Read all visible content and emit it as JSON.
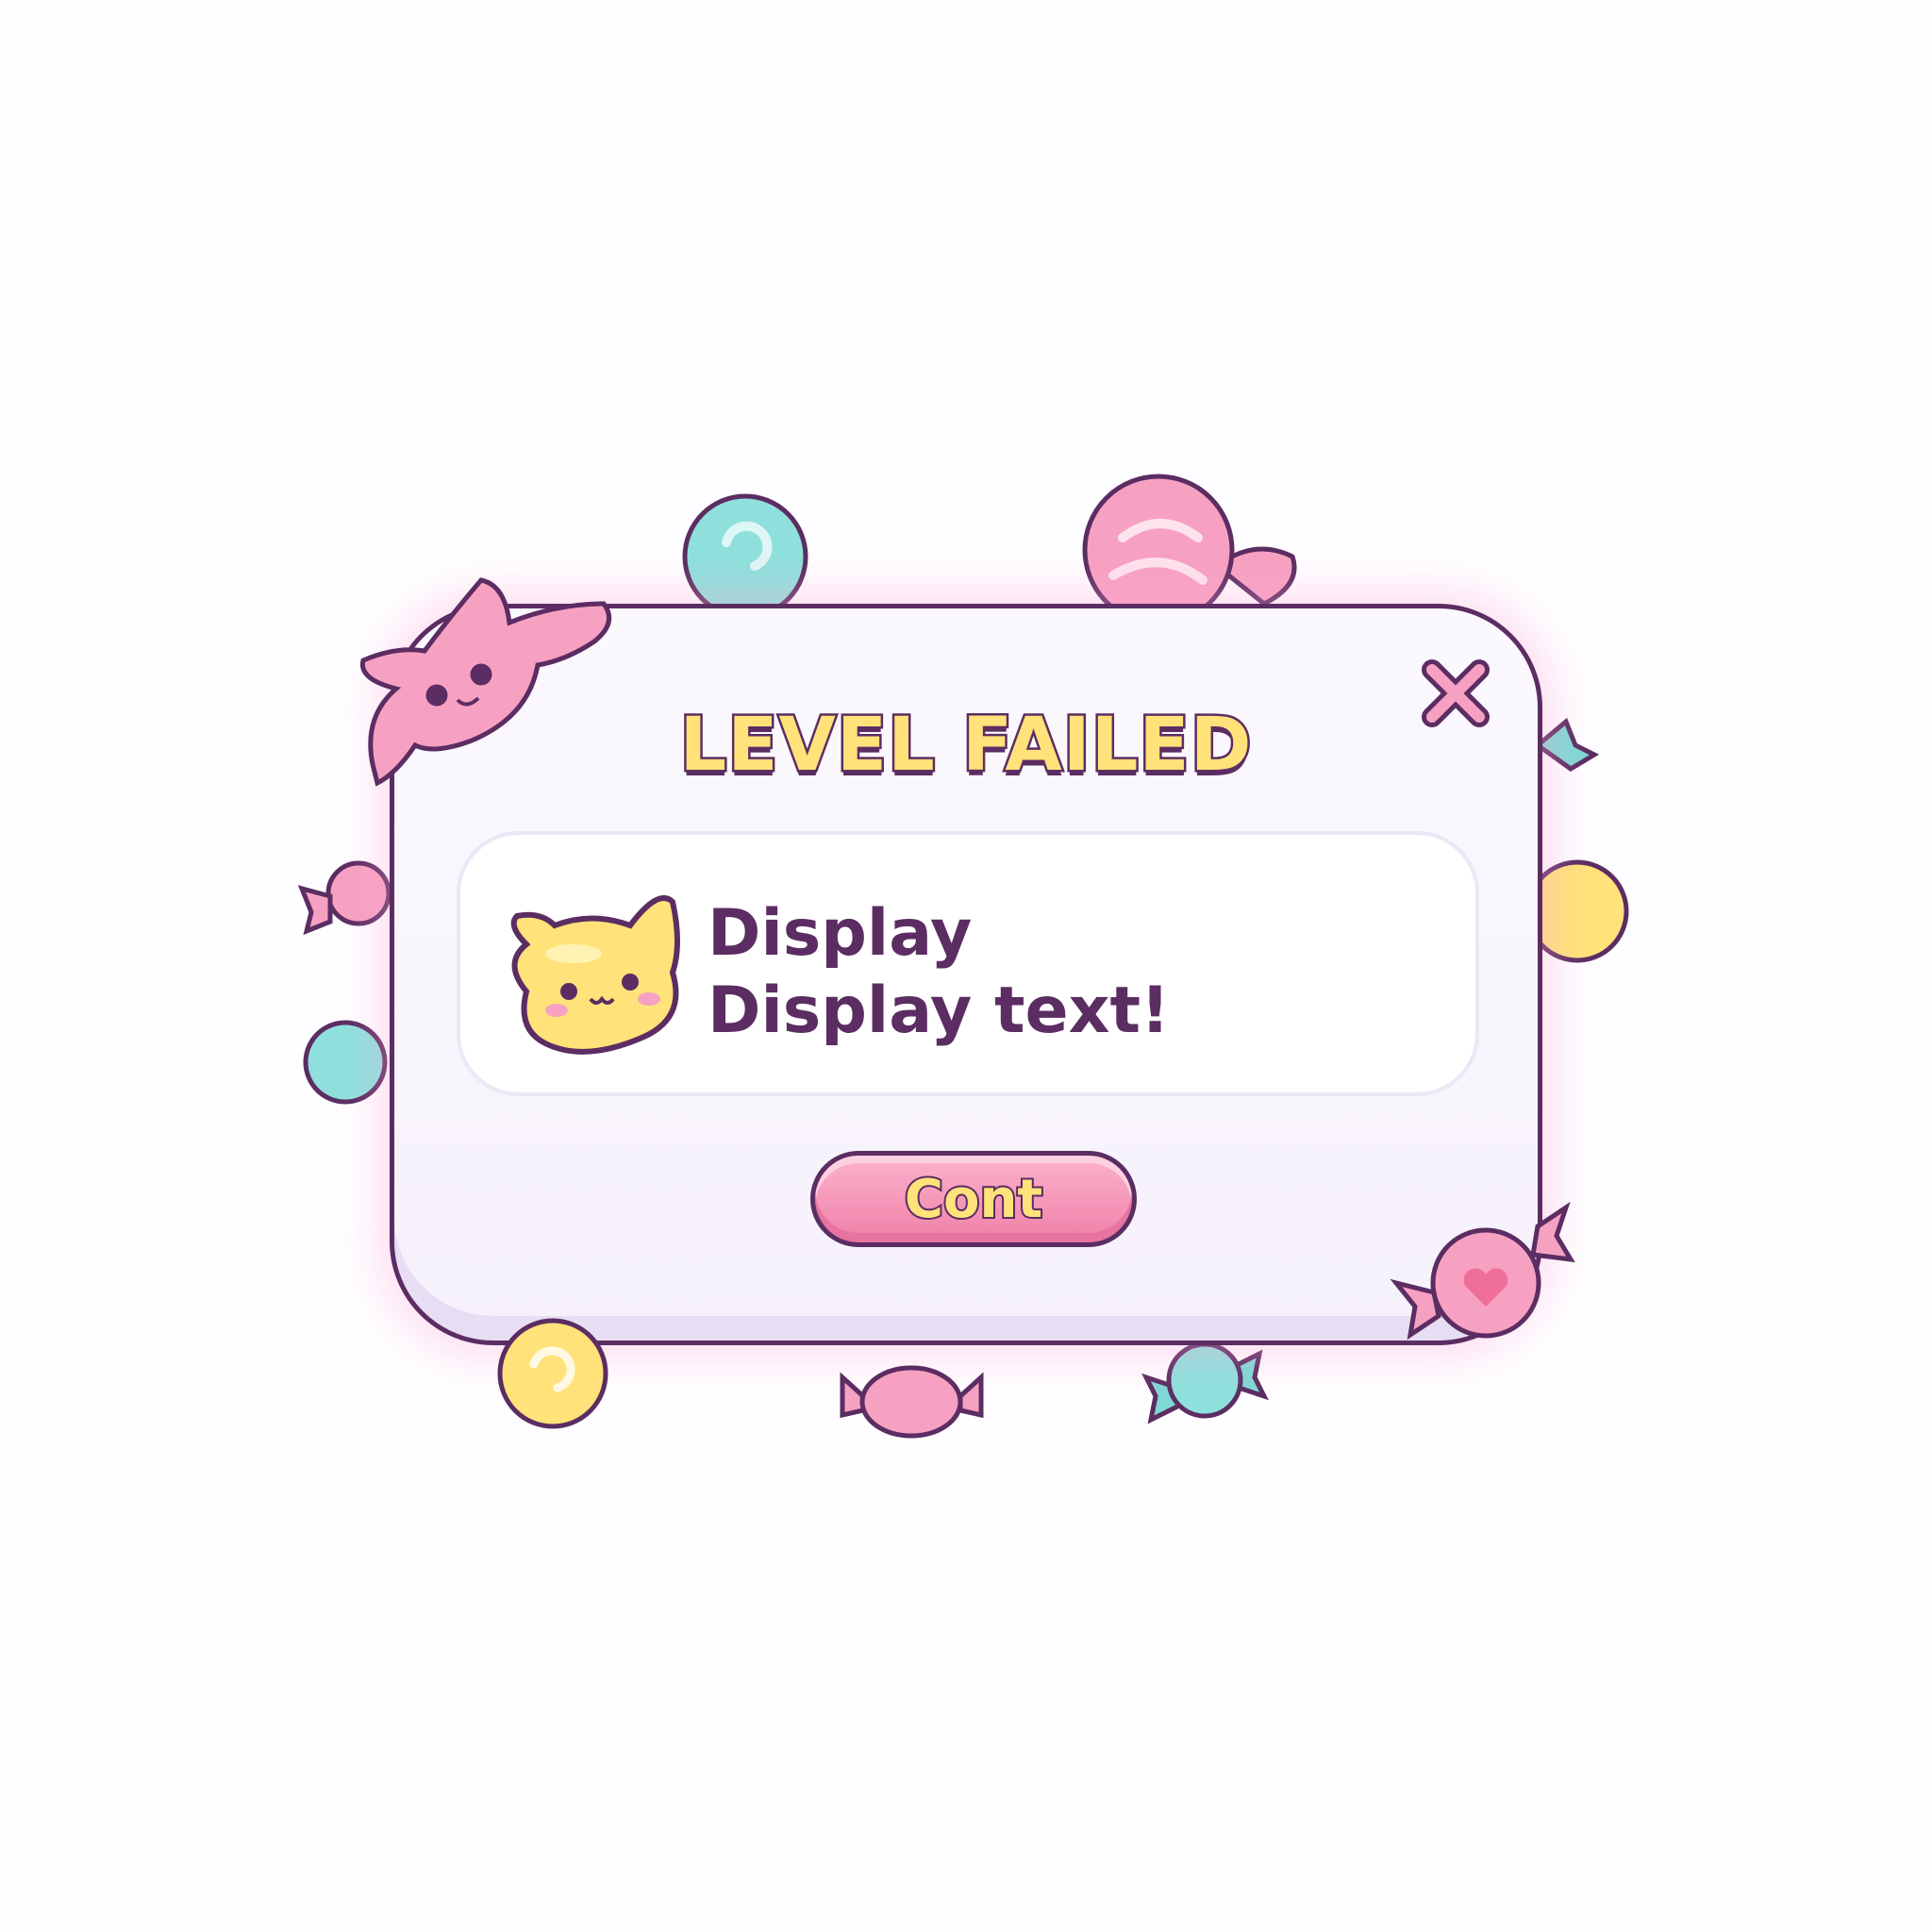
{
  "dialog": {
    "title": "LEVEL FAILED",
    "message": "Display Display text!",
    "continue_label": "Cont",
    "close_icon": "close-x-icon",
    "mascot_icon": "yellow-cat-candy-icon"
  },
  "colors": {
    "outline": "#5b2d62",
    "title_fill": "#ffe27a",
    "button_pink": "#f48fb4",
    "candy_pink": "#f7a1c2",
    "candy_teal": "#7fd8d4",
    "candy_yellow": "#ffe27a"
  }
}
